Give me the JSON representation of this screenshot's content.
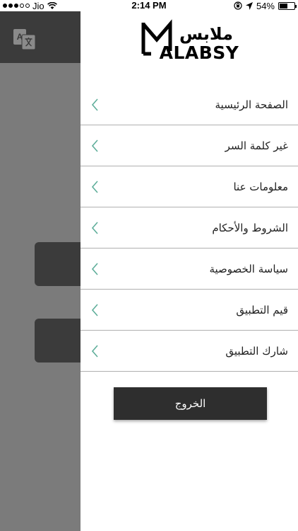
{
  "status_bar": {
    "carrier": "Jio",
    "time": "2:14 PM",
    "battery": "54%",
    "battery_level": 0.54
  },
  "header": {
    "logo_arabic": "ملابس",
    "logo_latin": "ALABSY"
  },
  "menu": {
    "items": [
      {
        "label": "الصفحة الرئيسية"
      },
      {
        "label": "غير كلمة السر"
      },
      {
        "label": "معلومات عنا"
      },
      {
        "label": "الشروط والأحكام"
      },
      {
        "label": "سياسة الخصوصية"
      },
      {
        "label": "قيم التطبيق"
      },
      {
        "label": "شارك التطبيق"
      }
    ]
  },
  "logout_label": "الخروج",
  "colors": {
    "accent": "#5fae9a",
    "drawer_bg": "#ffffff",
    "overlay": "#7b7b7b",
    "dark": "#2e2e2e"
  }
}
